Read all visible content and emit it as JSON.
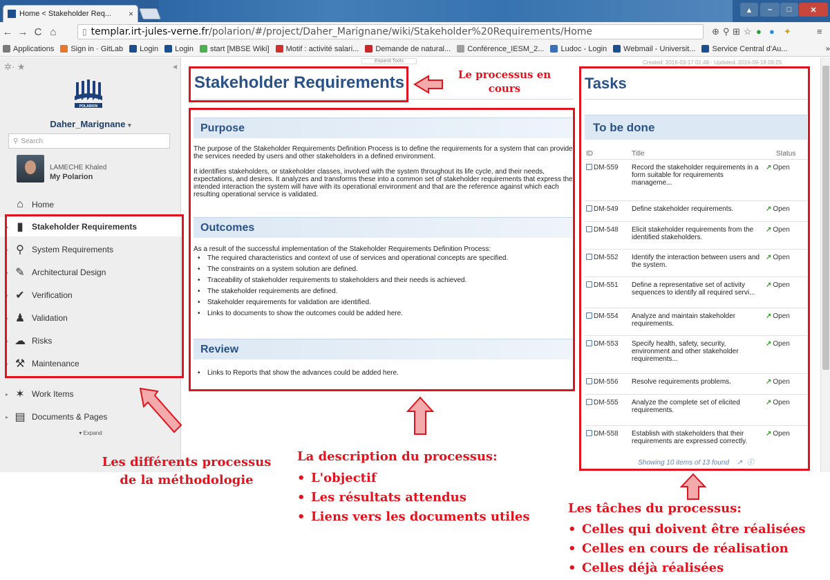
{
  "browser": {
    "tab_title": "Home < Stakeholder Req...",
    "tab_close": "×",
    "url_host": "templar.irt-jules-verne.fr",
    "url_path": "/polarion/#/project/Daher_Marignane/wiki/Stakeholder%20Requirements/Home",
    "bookmarks": [
      {
        "label": "Applications",
        "color": "#7a7a7a"
      },
      {
        "label": "Sign in · GitLab",
        "color": "#e8772e"
      },
      {
        "label": "Login",
        "color": "#1c4f8f"
      },
      {
        "label": "Login",
        "color": "#1c4f8f"
      },
      {
        "label": "start [MBSE Wiki]",
        "color": "#4caf50"
      },
      {
        "label": "Motif : activité salari...",
        "color": "#d32f2f"
      },
      {
        "label": "Demande de natural...",
        "color": "#c62828"
      },
      {
        "label": "Conférence_IESM_2...",
        "color": "#9e9e9e"
      },
      {
        "label": "Ludoc - Login",
        "color": "#3b6fb6"
      },
      {
        "label": "Webmail - Universit...",
        "color": "#1c4f8f"
      },
      {
        "label": "Service Central d'Au...",
        "color": "#1c4f8f"
      }
    ]
  },
  "sidebar": {
    "project": "Daher_Marignane",
    "project_caret": "▾",
    "search_placeholder": "Search",
    "user_name": "LAMECHE Khaled",
    "my_polarion": "My Polarion",
    "home": "Home",
    "items": [
      {
        "label": "Stakeholder Requirements",
        "icon": "book-icon"
      },
      {
        "label": "System Requirements",
        "icon": "search-icon"
      },
      {
        "label": "Architectural Design",
        "icon": "pencil-icon"
      },
      {
        "label": "Verification",
        "icon": "check-icon"
      },
      {
        "label": "Validation",
        "icon": "user-icon"
      },
      {
        "label": "Risks",
        "icon": "cloud-icon"
      },
      {
        "label": "Maintenance",
        "icon": "wrench-icon"
      }
    ],
    "work_items": "Work Items",
    "documents": "Documents & Pages",
    "expand": "▾ Expand"
  },
  "page": {
    "created": "Created: 2016-03-17 01:48 · Updated: 2016-09-18 09:25",
    "expand_tools": "Expand Tools",
    "title": "Stakeholder Requirements",
    "purpose_heading": "Purpose",
    "purpose_p1": "The purpose of the Stakeholder Requirements Definition Process is to define the requirements for a system that can provide the services needed by users and other stakeholders in a defined environment.",
    "purpose_p2": "It identifies stakeholders, or stakeholder classes, involved with the system throughout its life cycle, and their needs, expectations, and desires. It analyzes and transforms these into a common set of stakeholder requirements that express the intended interaction the system will have with its operational environment and that are the reference against which each resulting operational service is validated.",
    "outcomes_heading": "Outcomes",
    "outcomes_intro": "As a result of the successful implementation of the Stakeholder Requirements Definition Process:",
    "outcomes": [
      "The required characteristics and context of use of services and operational concepts are specified.",
      "The constraints on a system solution are defined.",
      "Traceability of stakeholder requirements to stakeholders and their needs is achieved.",
      "The stakeholder requirements are defined.",
      "Stakeholder requirements for validation are identified.",
      "Links to documents to show the outcomes could be added here."
    ],
    "review_heading": "Review",
    "review_items": [
      "Links to Reports that show the advances could be added here."
    ]
  },
  "tasks": {
    "title": "Tasks",
    "to_be_done": "To be done",
    "col_id": "ID",
    "col_title": "Title",
    "col_status": "Status",
    "rows": [
      {
        "id": "DM-559",
        "title": "Record the stakeholder requirements in a form suitable for requirements manageme...",
        "status": "Open"
      },
      {
        "id": "DM-549",
        "title": "Define stakeholder requirements.",
        "status": "Open"
      },
      {
        "id": "DM-548",
        "title": "Elicit stakeholder requirements from the identified stakeholders.",
        "status": "Open"
      },
      {
        "id": "DM-552",
        "title": "Identify the interaction between users and the system.",
        "status": "Open"
      },
      {
        "id": "DM-551",
        "title": "Define a representative set of activity sequences to identify all required servi...",
        "status": "Open"
      },
      {
        "id": "DM-554",
        "title": "Analyze and maintain stakeholder requirements.",
        "status": "Open"
      },
      {
        "id": "DM-553",
        "title": "Specify health, safety, security, environment and other stakeholder requirements...",
        "status": "Open"
      },
      {
        "id": "DM-556",
        "title": "Resolve requirements problems.",
        "status": "Open"
      },
      {
        "id": "DM-555",
        "title": "Analyze the complete set of elicited requirements.",
        "status": "Open"
      },
      {
        "id": "DM-558",
        "title": "Establish with stakeholders that their requirements are expressed correctly.",
        "status": "Open"
      }
    ],
    "showing": "Showing 10 items of 13 found"
  },
  "annotations": {
    "current_process_1": "Le processus en",
    "current_process_2": "cours",
    "processes_1": "Les différents processus",
    "processes_2": "de la méthodologie",
    "description_title": "La description du processus:",
    "description_items": [
      "L'objectif",
      "Les résultats attendus",
      "Liens vers les documents utiles"
    ],
    "tasks_title": "Les tâches du processus:",
    "tasks_items": [
      "Celles qui doivent être réalisées",
      "Celles en cours de réalisation",
      "Celles déjà réalisées"
    ],
    "color": "#e0141e"
  }
}
